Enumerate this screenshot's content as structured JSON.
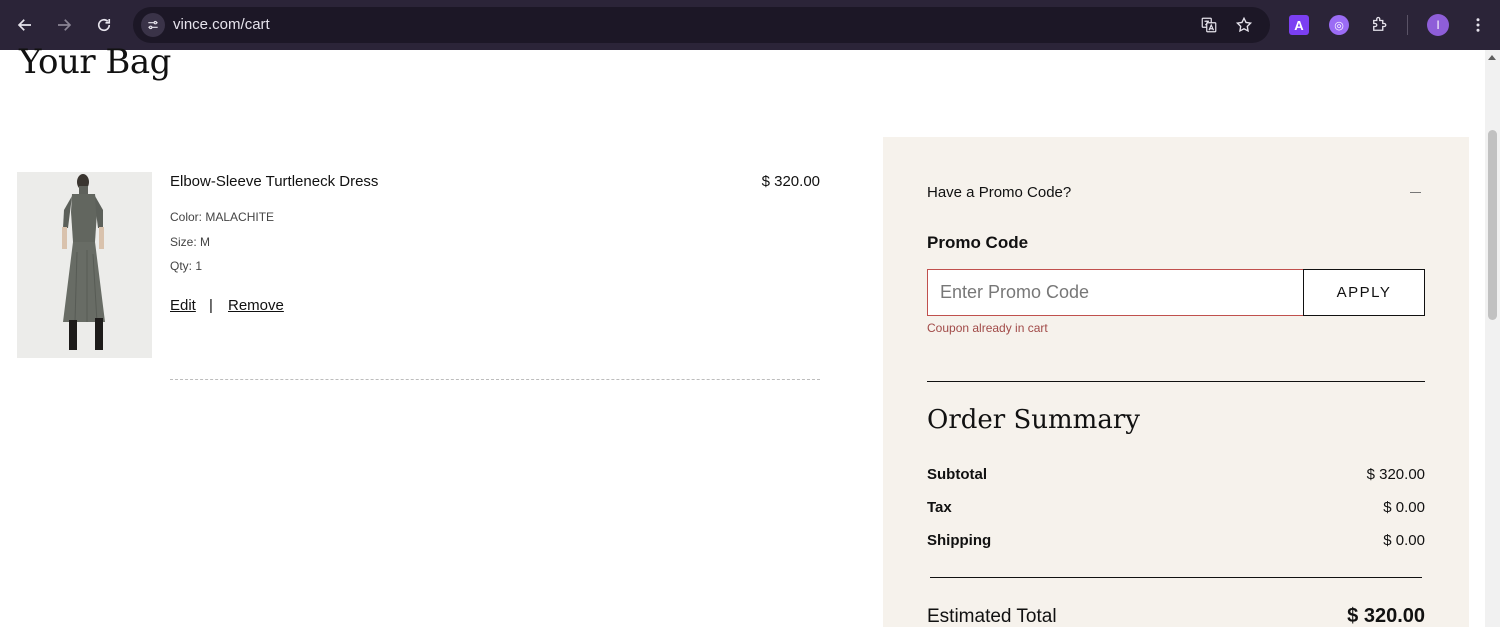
{
  "browser": {
    "url": "vince.com/cart",
    "profile_initial": "I",
    "extensions": [
      "translate-icon",
      "bookmark-star-icon",
      "extension-a-icon",
      "extension-c-icon",
      "extensions-puzzle-icon"
    ]
  },
  "page": {
    "title": "Your Bag"
  },
  "cart": {
    "items": [
      {
        "name": "Elbow-Sleeve Turtleneck Dress",
        "price": "$ 320.00",
        "color": "Color: MALACHITE",
        "size": "Size: M",
        "qty": "Qty: 1",
        "edit_label": "Edit",
        "separator": "|",
        "remove_label": "Remove"
      }
    ]
  },
  "promo": {
    "toggle_label": "Have a Promo Code?",
    "label": "Promo Code",
    "placeholder": "Enter Promo Code",
    "apply_label": "APPLY",
    "error": "Coupon already in cart"
  },
  "summary": {
    "title": "Order Summary",
    "subtotal_label": "Subtotal",
    "subtotal_value": "$ 320.00",
    "tax_label": "Tax",
    "tax_value": "$ 0.00",
    "shipping_label": "Shipping",
    "shipping_value": "$ 0.00",
    "total_label": "Estimated Total",
    "total_value": "$ 320.00"
  },
  "colors": {
    "chrome_bg": "#2b2438",
    "summary_bg": "#f6f2ec",
    "error": "#a14a48"
  }
}
